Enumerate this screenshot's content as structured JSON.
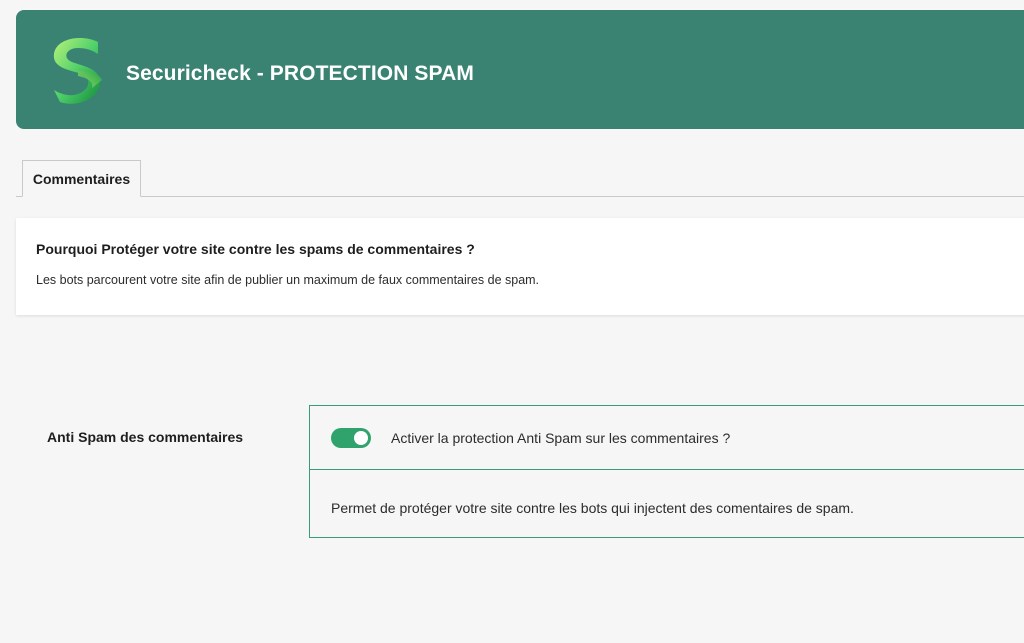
{
  "header": {
    "title": "Securicheck - PROTECTION SPAM",
    "logo_icon": "securicheck-s-logo",
    "background_color": "#3a8373"
  },
  "tabs": [
    {
      "label": "Commentaires",
      "active": true
    }
  ],
  "info": {
    "title": "Pourquoi Protéger votre site contre les spams de commentaires ?",
    "text": "Les bots parcourent votre site afin de publier un maximum de faux commentaires de spam."
  },
  "setting": {
    "label": "Anti Spam des commentaires",
    "toggle_label": "Activer la protection Anti Spam sur les commentaires ?",
    "toggle_on": true,
    "toggle_color": "#2fa36b",
    "description": "Permet de protéger votre site contre les bots qui injectent des comentaires de spam."
  }
}
